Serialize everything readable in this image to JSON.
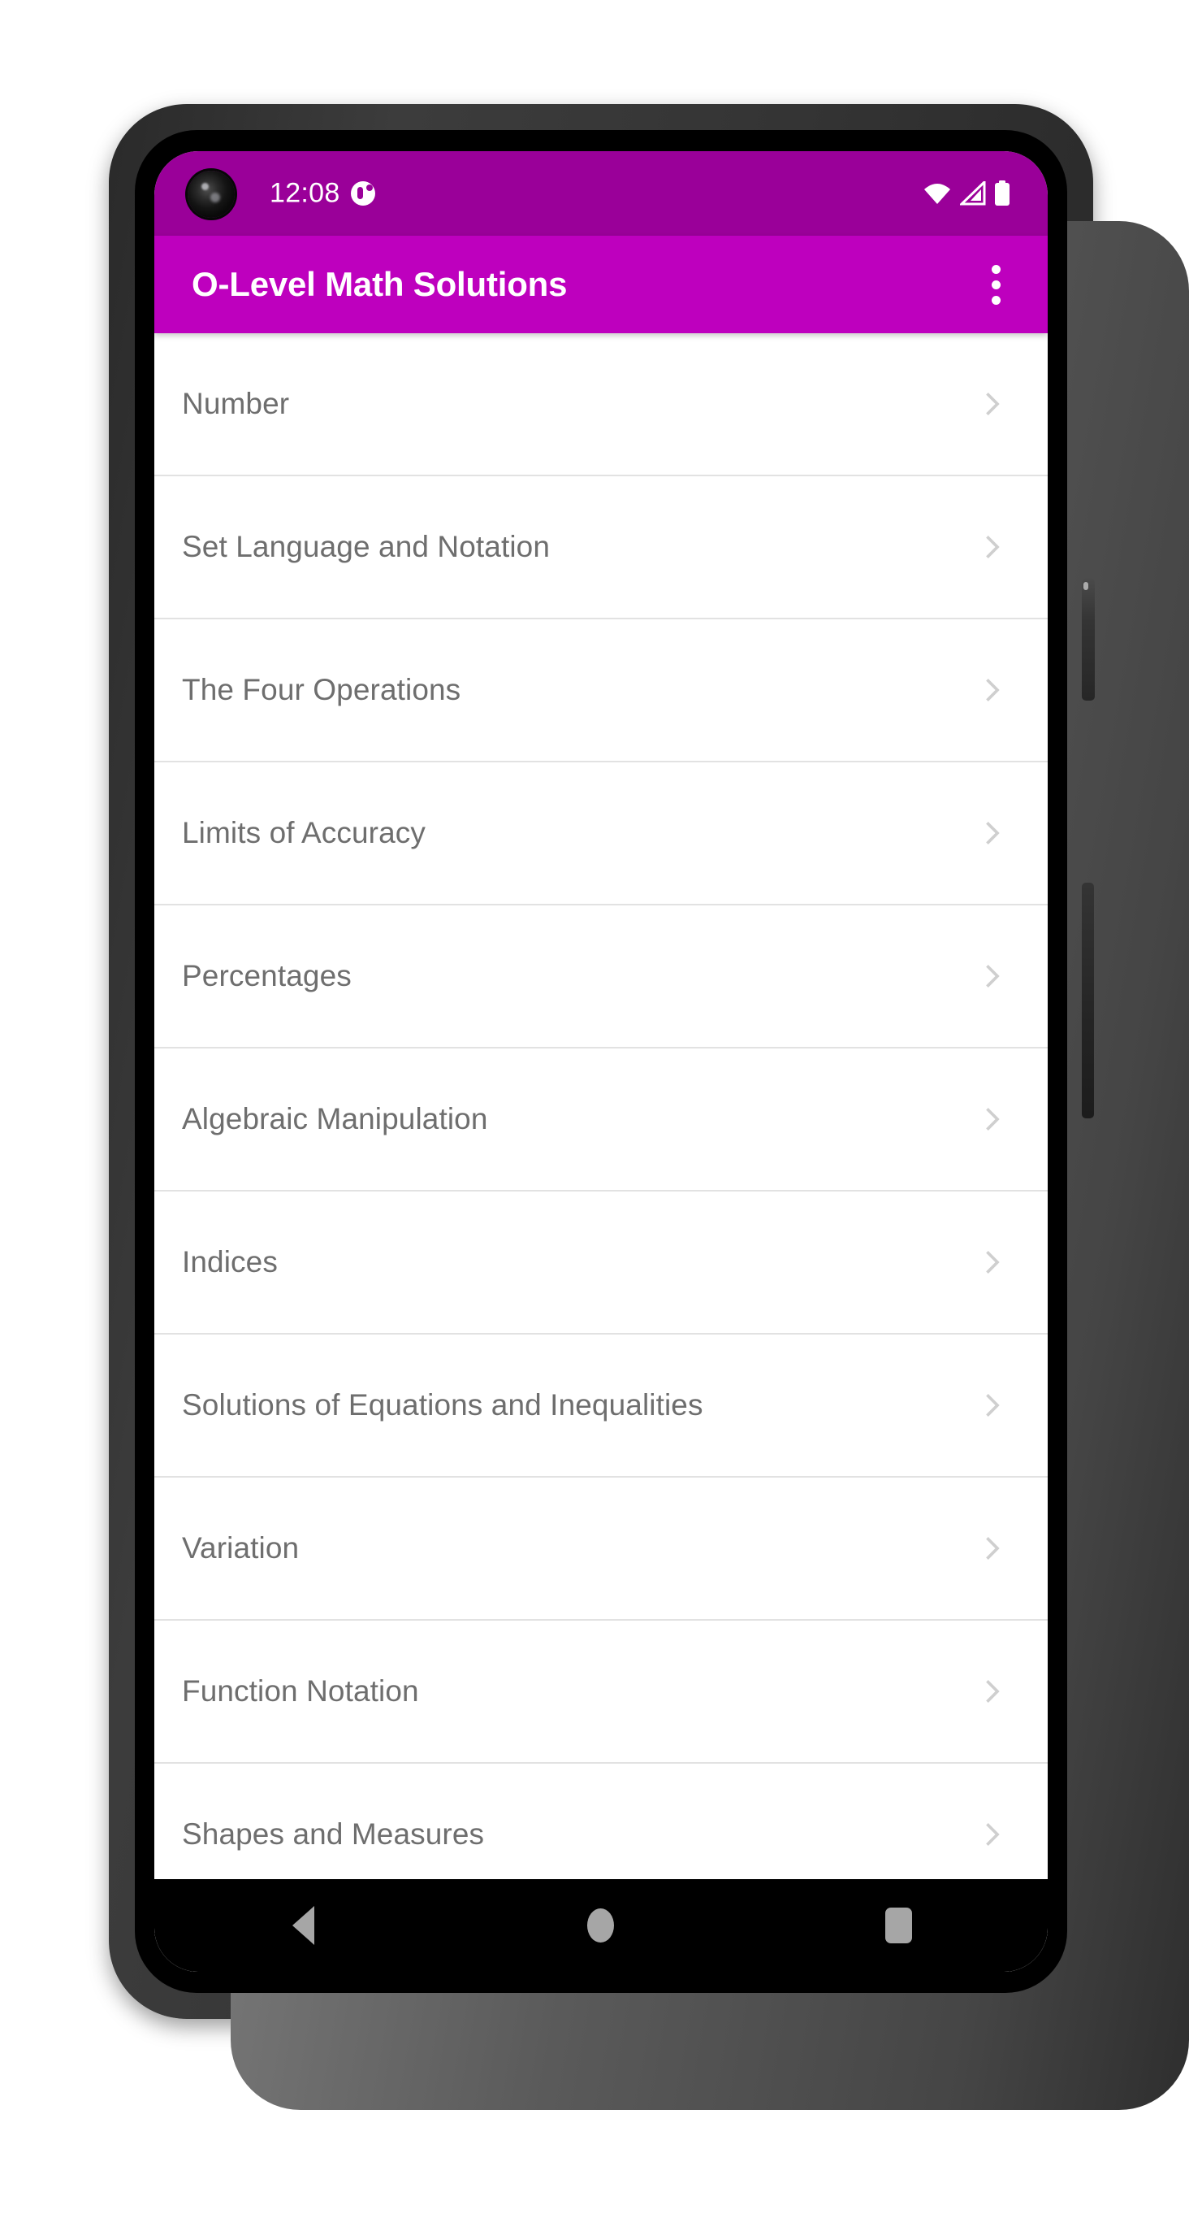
{
  "colors": {
    "status_bar": "#9A0099",
    "app_bar": "#BE00BE",
    "list_text": "#6E6E6E",
    "divider": "#E2E2E2",
    "nav_icon": "#A6A6A6",
    "screen_bg": "#FFFFFF"
  },
  "status_bar": {
    "time": "12:08",
    "notification_icon": "notification-dot-icon",
    "camera_icon": "front-camera-punchhole",
    "wifi_icon": "wifi-icon",
    "signal_icon": "cellular-signal-icon",
    "battery_icon": "battery-full-icon"
  },
  "app_bar": {
    "title": "O-Level Math Solutions",
    "overflow_menu": "overflow-menu-icon"
  },
  "list": {
    "items": [
      {
        "label": "Number",
        "chevron": "chevron-right-icon"
      },
      {
        "label": "Set Language and Notation",
        "chevron": "chevron-right-icon"
      },
      {
        "label": "The Four Operations",
        "chevron": "chevron-right-icon"
      },
      {
        "label": "Limits of Accuracy",
        "chevron": "chevron-right-icon"
      },
      {
        "label": "Percentages",
        "chevron": "chevron-right-icon"
      },
      {
        "label": "Algebraic Manipulation",
        "chevron": "chevron-right-icon"
      },
      {
        "label": "Indices",
        "chevron": "chevron-right-icon"
      },
      {
        "label": "Solutions of Equations and Inequalities",
        "chevron": "chevron-right-icon"
      },
      {
        "label": "Variation",
        "chevron": "chevron-right-icon"
      },
      {
        "label": "Function Notation",
        "chevron": "chevron-right-icon"
      },
      {
        "label": "Shapes and Measures",
        "chevron": "chevron-right-icon"
      }
    ]
  },
  "nav_bar": {
    "back": "back-triangle-icon",
    "home": "home-circle-icon",
    "recents": "recents-square-icon"
  },
  "hardware": {
    "power_button": "power-button",
    "volume_button": "volume-rocker-button"
  }
}
